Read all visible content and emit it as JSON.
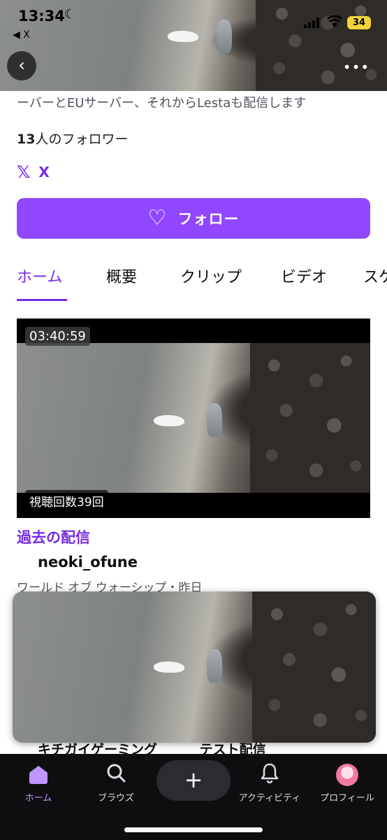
{
  "status_bar": {
    "time": "13:34",
    "moon_icon": "☾",
    "back_app": "◀ X",
    "battery": "34"
  },
  "banner": {
    "back_icon": "‹",
    "more_icon": "•••"
  },
  "profile": {
    "description": "ーバーとEUサーバー、それからLestaも配信します",
    "followers_count": "13",
    "followers_text": "人のフォロワー",
    "social_logo": "𝕏",
    "social_label": "X"
  },
  "follow_button": {
    "icon": "♡",
    "label": "フォロー"
  },
  "tabs": [
    {
      "label": "ホーム"
    },
    {
      "label": "概要"
    },
    {
      "label": "クリップ"
    },
    {
      "label": "ビデオ"
    },
    {
      "label": "スケ"
    }
  ],
  "video_card": {
    "duration": "03:40:59",
    "views": "視聴回数39回",
    "category_label": "過去の配信",
    "title": "neoki_ofune",
    "meta": "ワールド オブ ウォーシップ・昨日"
  },
  "next_titles": [
    "キチガイゲーミング",
    "テスト配信"
  ],
  "bottom_nav": [
    {
      "label": "ホーム",
      "icon": "home-icon"
    },
    {
      "label": "ブラウズ",
      "icon": "search-icon"
    },
    {
      "label": "+",
      "icon": "plus-icon"
    },
    {
      "label": "アクティビティ",
      "icon": "bell-icon"
    },
    {
      "label": "プロフィール",
      "icon": "avatar"
    }
  ],
  "colors": {
    "accent": "#9147ff",
    "accent_text": "#772ce8",
    "nav_background": "#0e0e10",
    "nav_active": "#bf94ff"
  }
}
